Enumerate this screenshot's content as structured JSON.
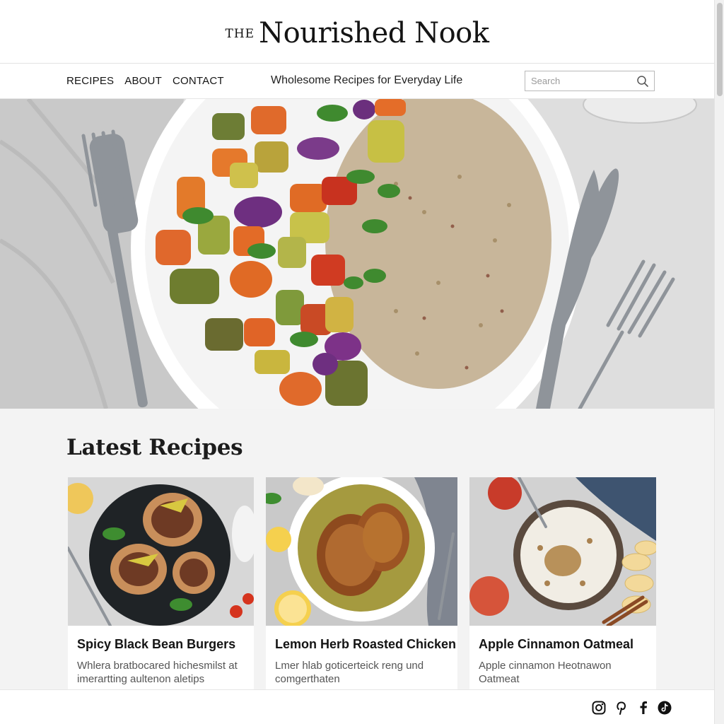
{
  "header": {
    "logo_prefix": "THE",
    "logo_name": "Nourished Nook"
  },
  "nav": {
    "links": [
      "RECIPES",
      "ABOUT",
      "CONTACT"
    ],
    "tagline": "Wholesome Recipes for Everyday Life"
  },
  "search": {
    "placeholder": "Search",
    "value": ""
  },
  "hero": {
    "alt": "Roasted vegetables and quinoa on a white plate"
  },
  "latest": {
    "title": "Latest Recipes",
    "cards": [
      {
        "title": "Spicy Black Bean Burgers",
        "description": "Whlera bratbocared hichesmilst at imerartting aultenon aletips"
      },
      {
        "title": "Lemon Herb Roasted Chicken",
        "description": "Lmer hlab goticerteick reng und comgerthaten"
      },
      {
        "title": "Apple Cinnamon Oatmeal",
        "description": "Apple cinnamon Heotnawon Oatmeat"
      }
    ]
  },
  "footer": {
    "social_icons": [
      "instagram-icon",
      "pinterest-icon",
      "facebook-icon",
      "tiktok-icon"
    ]
  },
  "colors": {
    "page_background": "#f3f3f3",
    "header_background": "#ffffff",
    "text_primary": "#1b1b1b",
    "text_secondary": "#555555"
  }
}
